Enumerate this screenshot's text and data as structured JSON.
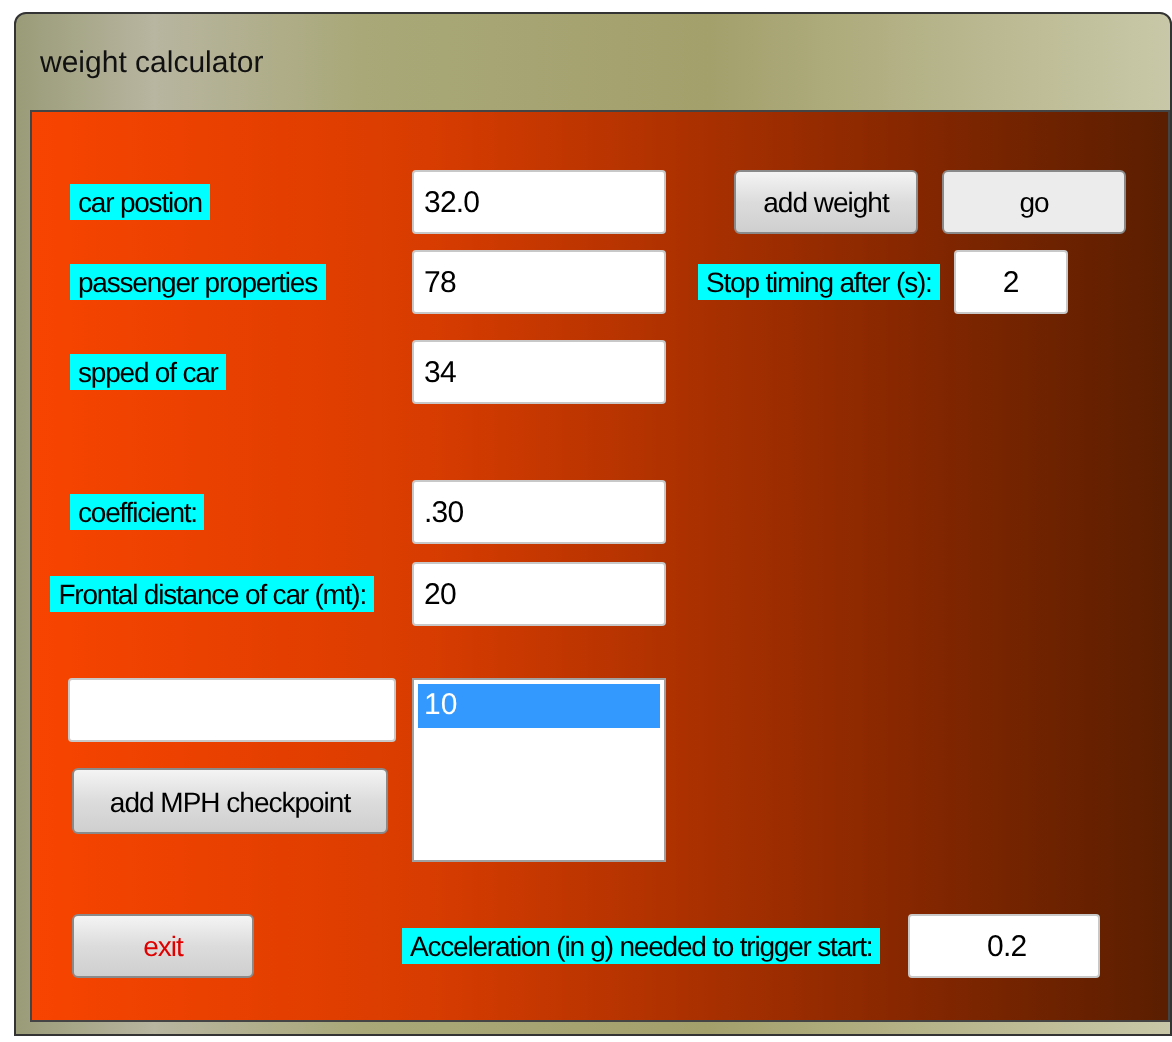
{
  "window": {
    "title": "weight calculator"
  },
  "fields": [
    {
      "label": "car postion",
      "value": "32.0"
    },
    {
      "label": "passenger properties",
      "value": "78"
    },
    {
      "label": "spped of car",
      "value": "34"
    },
    {
      "label": "coefficient:",
      "value": ".30"
    },
    {
      "label": "Frontal distance of car (mt):",
      "value": "20"
    }
  ],
  "buttons": [
    {
      "label": "add weight"
    },
    {
      "label": "go"
    }
  ],
  "stop_timing": {
    "label": "Stop timing after (s):",
    "value": "2"
  },
  "checkpoint_list": [
    {
      "text": "10",
      "selected": true
    }
  ],
  "add_checkpoint_button": {
    "label": "add MPH checkpoint"
  },
  "exit_button": {
    "label": "exit"
  },
  "acceleration": {
    "label": "Acceleration (in g) needed to trigger start:",
    "value": "0.2"
  }
}
